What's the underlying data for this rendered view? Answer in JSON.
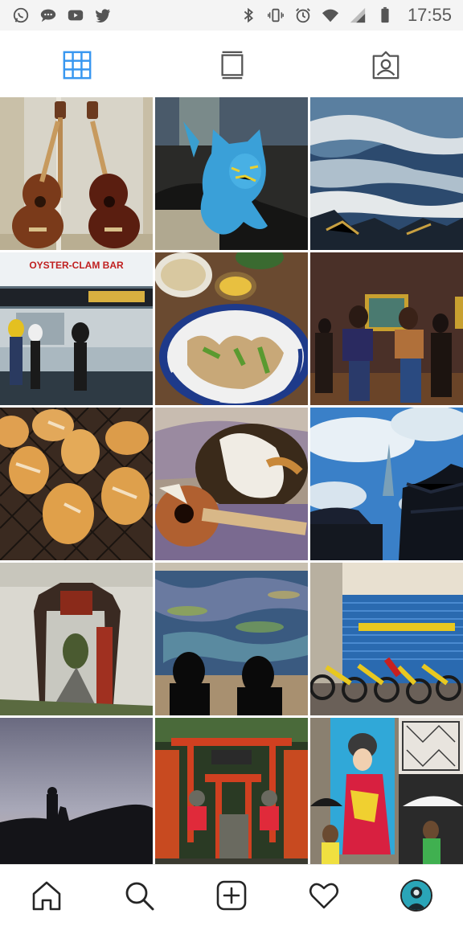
{
  "status_bar": {
    "left_icons": [
      "whatsapp-icon",
      "chat-bubble-icon",
      "youtube-icon",
      "twitter-icon"
    ],
    "right_icons": [
      "bluetooth-icon",
      "vibrate-icon",
      "alarm-icon",
      "wifi-icon",
      "signal-icon",
      "battery-icon"
    ],
    "time": "17:55"
  },
  "tabs": {
    "items": [
      {
        "name": "grid-view",
        "icon": "grid-icon",
        "active": true
      },
      {
        "name": "feed-view",
        "icon": "single-post-icon",
        "active": false
      },
      {
        "name": "tagged-view",
        "icon": "tagged-person-icon",
        "active": false
      }
    ],
    "accent_color": "#3897f0",
    "inactive_color": "#555555"
  },
  "grid": {
    "photos": [
      {
        "subject": "two ukuleles by window"
      },
      {
        "subject": "blue crocheted cat"
      },
      {
        "subject": "ocean waves on rocks"
      },
      {
        "subject": "oyster clam bar counter",
        "visible_text": "OYSTER-CLAM BAR"
      },
      {
        "subject": "blue plate of food"
      },
      {
        "subject": "museum visitors viewing painting"
      },
      {
        "subject": "bread rolls on rack"
      },
      {
        "subject": "cat and ukulele"
      },
      {
        "subject": "pagoda roof and tower"
      },
      {
        "subject": "chinese garden doorway"
      },
      {
        "subject": "water lilies painting viewers"
      },
      {
        "subject": "bicycles before blue shutter"
      },
      {
        "subject": "silhouette statue at dusk"
      },
      {
        "subject": "red torii shrine"
      },
      {
        "subject": "street mural with umbrella"
      }
    ]
  },
  "bottom_nav": {
    "items": [
      {
        "name": "home",
        "icon": "home-icon"
      },
      {
        "name": "search",
        "icon": "search-icon"
      },
      {
        "name": "new-post",
        "icon": "add-post-icon"
      },
      {
        "name": "activity",
        "icon": "heart-icon"
      },
      {
        "name": "profile",
        "icon": "avatar"
      }
    ]
  }
}
